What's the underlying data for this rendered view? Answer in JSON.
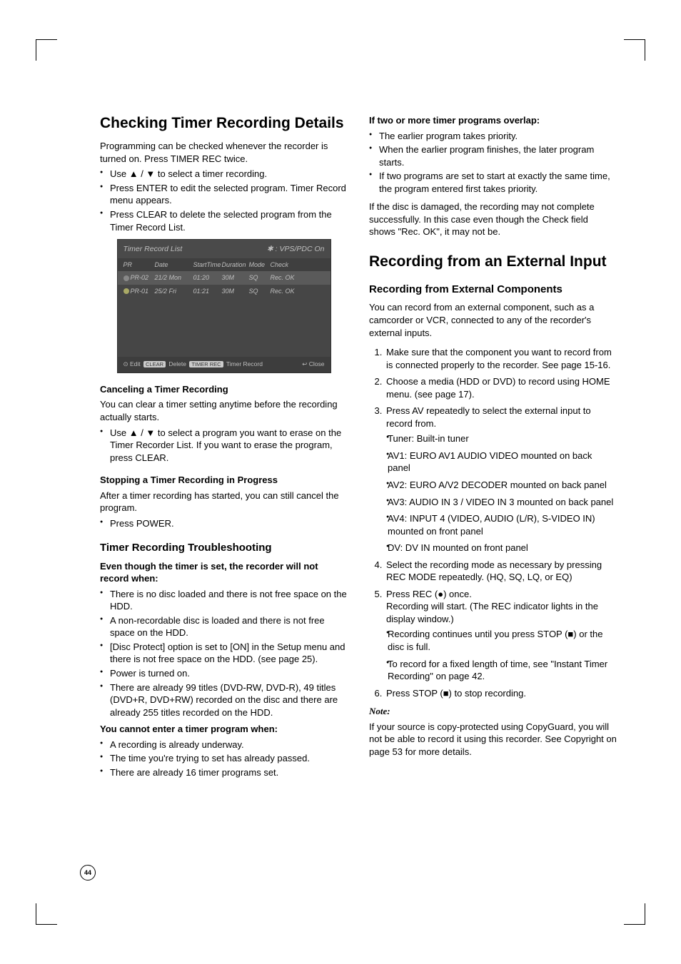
{
  "page_number": "44",
  "left": {
    "h2": "Checking Timer Recording Details",
    "intro": "Programming can be checked whenever the recorder is turned on. Press TIMER REC twice.",
    "intro_bullets": [
      "Use ▲ / ▼ to select a timer recording.",
      "Press ENTER to edit the selected program. Timer Record menu appears.",
      "Press CLEAR to delete the selected program from the Timer Record List."
    ],
    "trl": {
      "title": "Timer Record List",
      "vps": "✱ : VPS/PDC On",
      "cols": [
        "PR",
        "Date",
        "StartTime",
        "Duration",
        "Mode",
        "Check"
      ],
      "rows": [
        [
          "PR-02",
          "21/2 Mon",
          "01:20",
          "30M",
          "SQ",
          "Rec. OK"
        ],
        [
          "PR-01",
          "25/2 Fri",
          "01:21",
          "30M",
          "SQ",
          "Rec. OK"
        ]
      ],
      "footer_left": "⊙ Edit   CLEAR  Delete   TIMER REC  Timer Record",
      "footer_right": "↩ Close"
    },
    "cancel_h": "Canceling a Timer Recording",
    "cancel_p": "You can clear a timer setting anytime before the recording actually starts.",
    "cancel_bullets": [
      "Use ▲ / ▼ to select a program you want to erase on the Timer Recorder List. If you want to erase the program, press CLEAR."
    ],
    "stop_h": "Stopping a Timer Recording in Progress",
    "stop_p": "After a timer recording has started, you can still cancel the program.",
    "stop_bullets": [
      "Press POWER."
    ],
    "ts_h": "Timer Recording Troubleshooting",
    "ts_even_h": "Even though the timer is set, the recorder will not record when:",
    "ts_even_bullets": [
      "There is no disc loaded and there is not free space on the HDD.",
      "A non-recordable disc is loaded and there is not free space on the HDD.",
      "[Disc Protect] option is set to [ON] in the Setup menu and there is not free space on the HDD. (see page 25).",
      "Power is turned on.",
      "There are already 99 titles (DVD-RW, DVD-R), 49 titles (DVD+R, DVD+RW) recorded on the disc and there are already 255 titles recorded on the HDD."
    ],
    "ts_cannot_h": "You cannot enter a timer program when:",
    "ts_cannot_bullets": [
      "A recording is already underway.",
      "The time you're trying to set has already passed.",
      "There are already 16 timer programs set."
    ]
  },
  "right": {
    "overlap_h": "If two or more timer programs overlap:",
    "overlap_bullets": [
      "The earlier program takes priority.",
      "When the earlier program finishes, the later program starts.",
      "If two programs are set to start at exactly the same time, the program entered first takes priority."
    ],
    "damage_p": "If the disc is damaged, the recording may not complete successfully. In this case even though the Check field shows \"Rec. OK\", it may not be.",
    "h2": "Recording from an External Input",
    "h3": "Recording from External Components",
    "intro": "You can record from an external component, such as a camcorder or VCR, connected to any of the recorder's external inputs.",
    "steps": [
      {
        "text": "Make sure that the component you want to record from is connected properly to the recorder. See page 15-16."
      },
      {
        "text": "Choose a media (HDD or DVD) to record using HOME menu. (see page 17)."
      },
      {
        "text": "Press AV repeatedly to select the external input to record from.",
        "sub": [
          "Tuner: Built-in tuner",
          "AV1: EURO AV1 AUDIO VIDEO mounted on back panel",
          "AV2: EURO A/V2 DECODER mounted on back panel",
          "AV3: AUDIO IN 3 / VIDEO IN 3 mounted on back panel",
          "AV4: INPUT 4 (VIDEO, AUDIO (L/R), S-VIDEO IN) mounted on front panel",
          "DV: DV IN mounted on front panel"
        ]
      },
      {
        "text": "Select the recording mode as necessary by pressing REC MODE repeatedly. (HQ, SQ, LQ, or EQ)"
      },
      {
        "text": "Press REC (●) once.\nRecording will start. (The REC indicator lights in the display window.)",
        "sub": [
          "Recording continues until you press STOP (■) or the disc is full.",
          "To record for a fixed length of time, see \"Instant Timer Recording\" on page 42."
        ]
      },
      {
        "text": "Press STOP (■) to stop recording."
      }
    ],
    "note_label": "Note:",
    "note_p": "If your source is copy-protected using CopyGuard, you will not be able to record it using this recorder. See Copyright on page 53 for more details."
  },
  "chart_data": {
    "type": "table",
    "title": "Timer Record List",
    "columns": [
      "PR",
      "Date",
      "StartTime",
      "Duration",
      "Mode",
      "Check"
    ],
    "rows": [
      [
        "PR-02",
        "21/2 Mon",
        "01:20",
        "30M",
        "SQ",
        "Rec. OK"
      ],
      [
        "PR-01",
        "25/2 Fri",
        "01:21",
        "30M",
        "SQ",
        "Rec. OK"
      ]
    ]
  }
}
